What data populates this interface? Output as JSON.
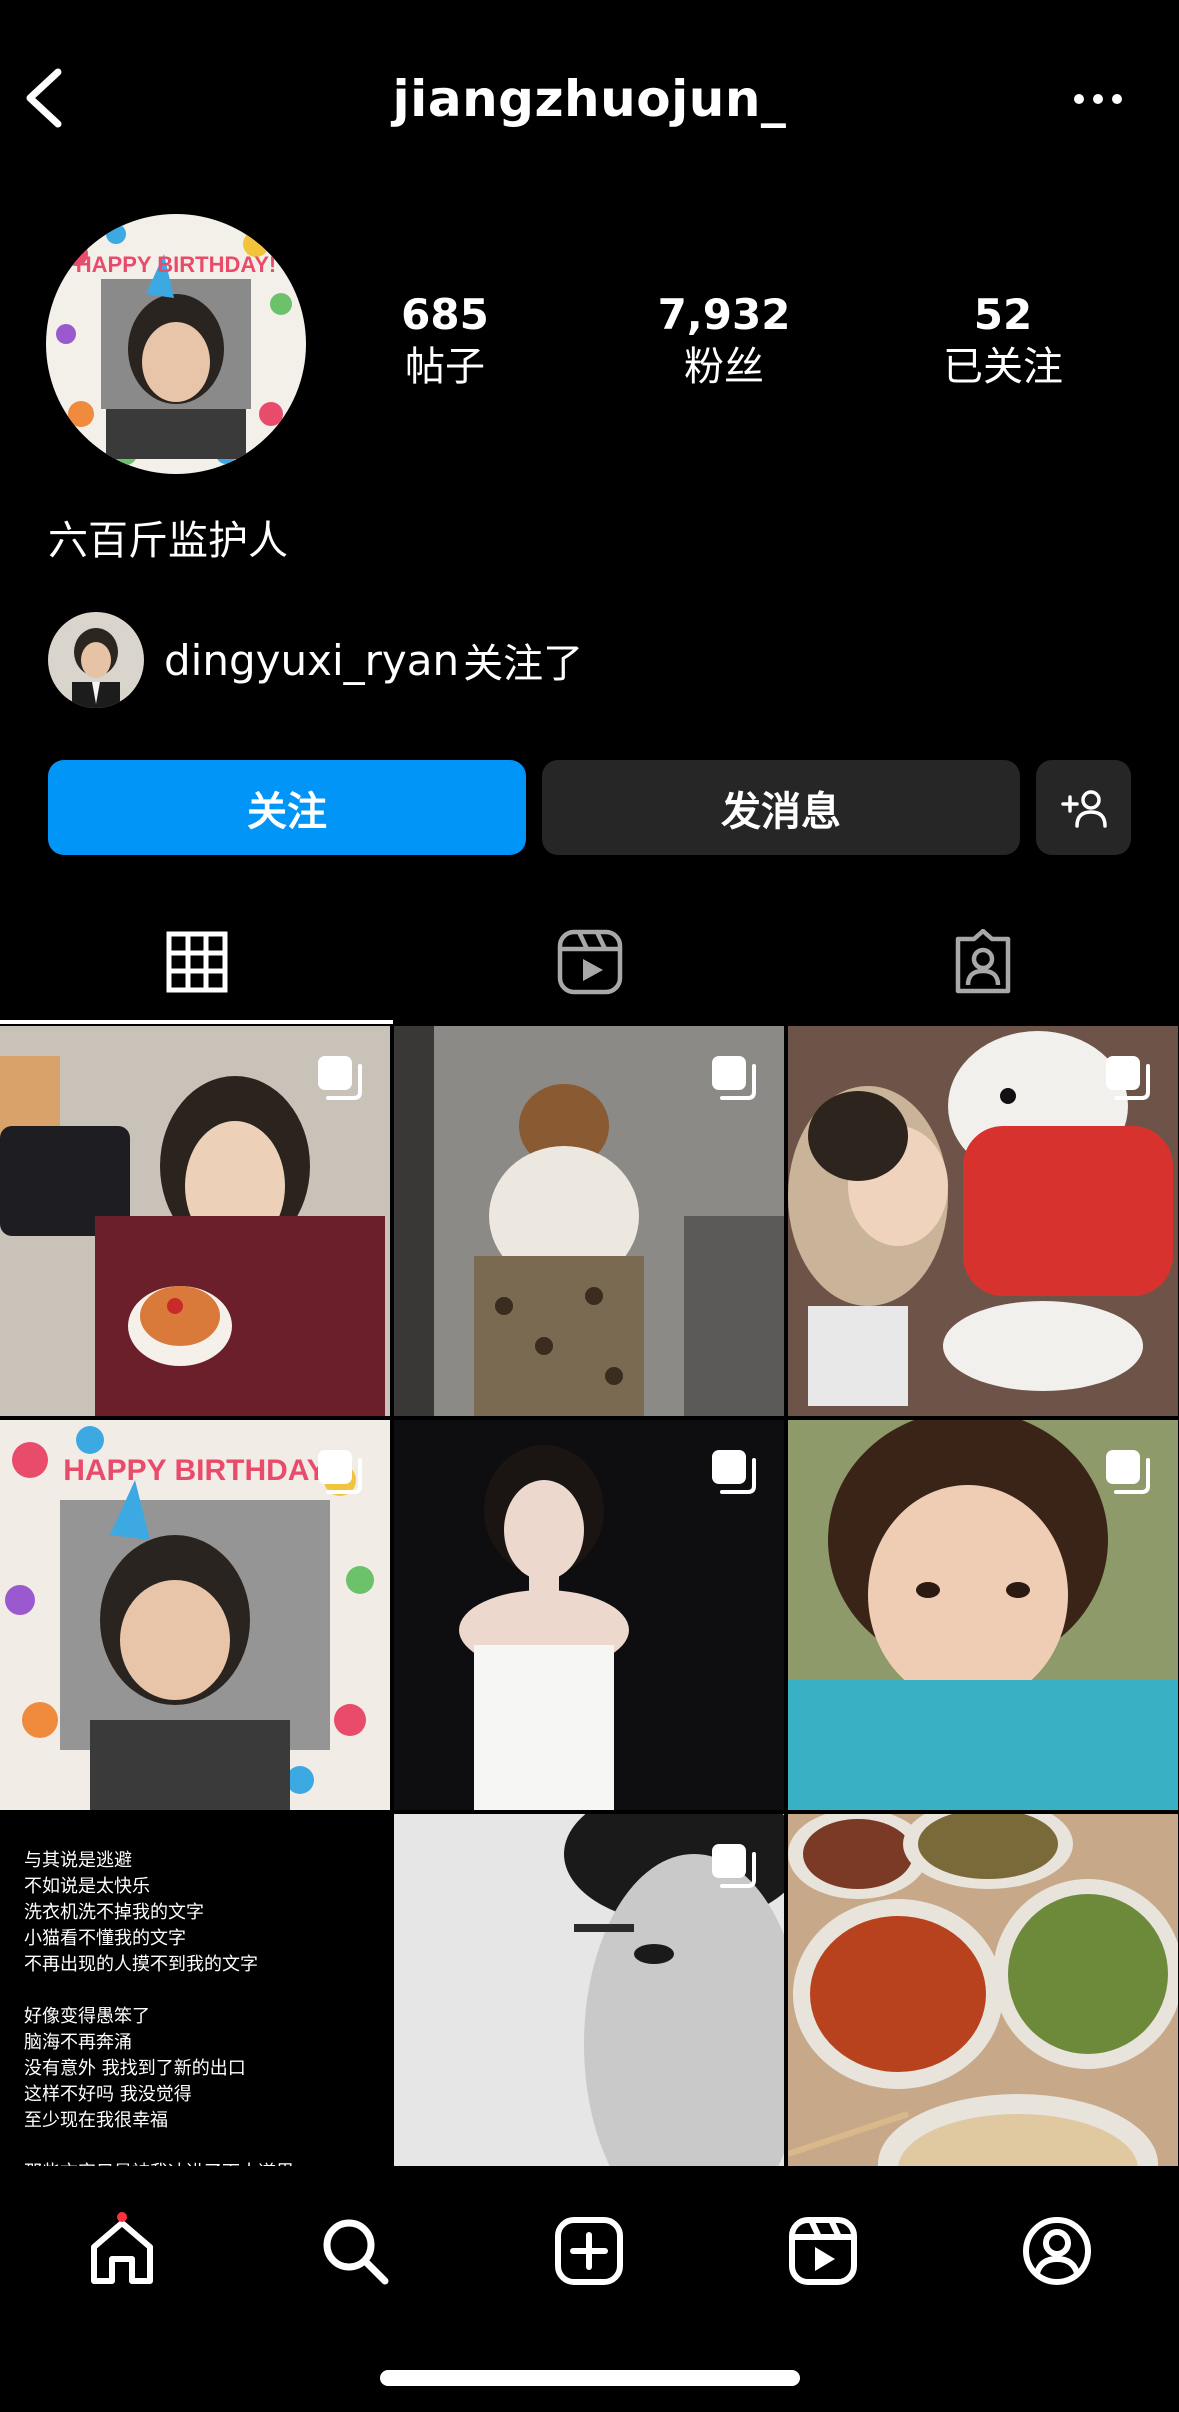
{
  "header": {
    "username": "jiangzhuojun_"
  },
  "profile": {
    "stats": [
      {
        "value": "685",
        "label": "帖子"
      },
      {
        "value": "7,932",
        "label": "粉丝"
      },
      {
        "value": "52",
        "label": "已关注"
      }
    ],
    "bio": "六百斤监护人",
    "followed_by": {
      "name": "dingyuxi_ryan",
      "suffix": "关注了"
    },
    "avatar_text": "HAPPY BIRTHDAY!"
  },
  "actions": {
    "follow_label": "关注",
    "message_label": "发消息"
  },
  "tabs": [
    {
      "icon": "grid-icon"
    },
    {
      "icon": "reels-icon"
    },
    {
      "icon": "tagged-icon"
    }
  ],
  "posts": {
    "birthday_text": "HAPPY BIRTHDAY!",
    "text_post": "与其说是逃避\n不如说是太快乐\n洗衣机洗不掉我的文字\n小猫看不懂我的文字\n不再出现的人摸不到我的文字\n\n好像变得愚笨了\n脑海不再奔涌\n没有意外 我找到了新的出口\n这样不好吗 我没觉得\n至少现在我很幸福\n\n那些文字只是被我冲进了下水道里\n需要的时候再捞起"
  },
  "colors": {
    "primary": "#0095f6",
    "secondary_button": "#262626",
    "notification_dot": "#ff3040"
  },
  "nav": [
    {
      "icon": "home-icon"
    },
    {
      "icon": "search-icon"
    },
    {
      "icon": "create-icon"
    },
    {
      "icon": "reels-icon"
    },
    {
      "icon": "profile-icon"
    }
  ]
}
